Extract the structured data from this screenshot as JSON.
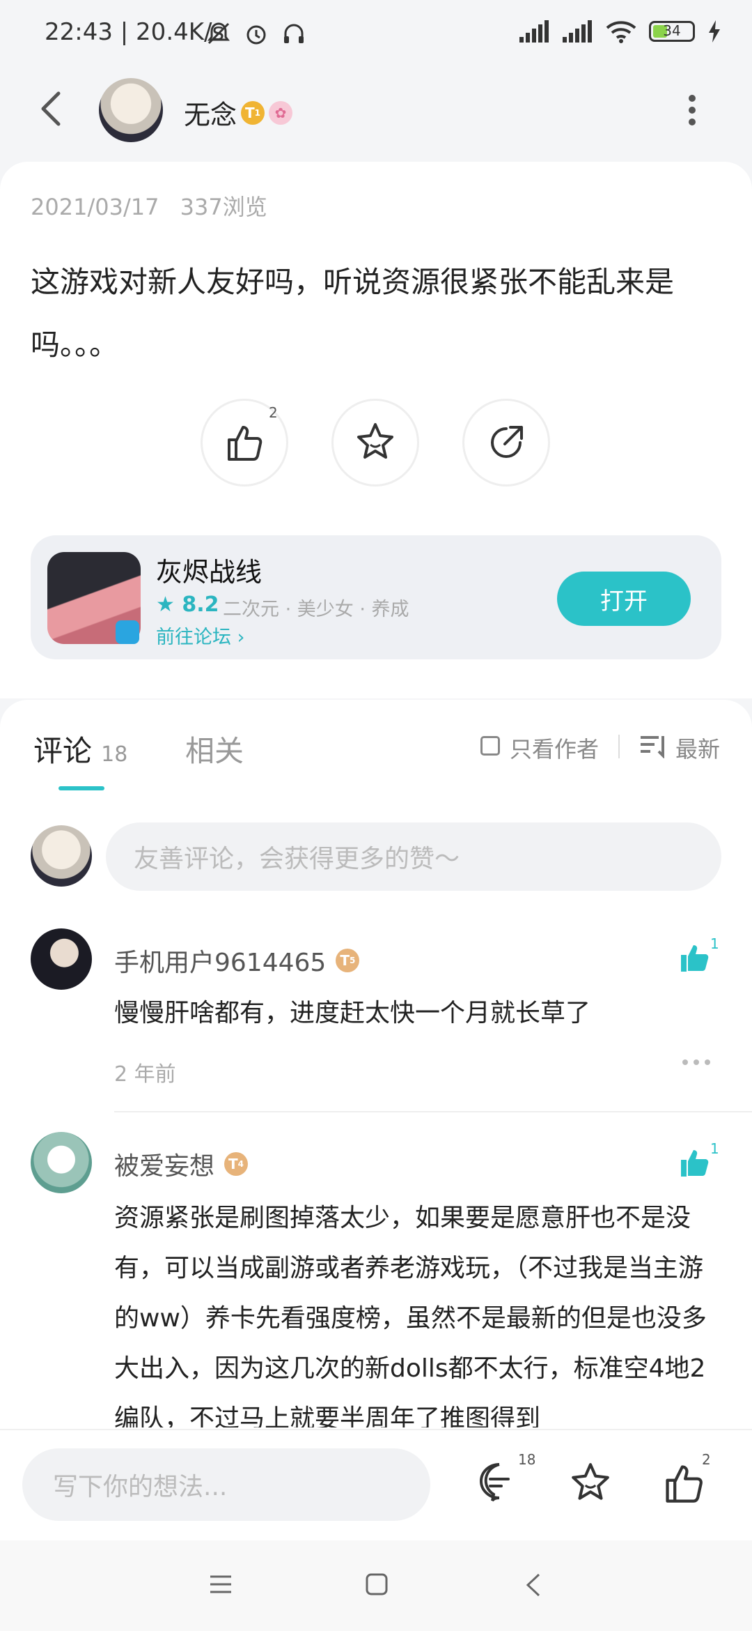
{
  "status_bar": {
    "time": "22:43 | 20.4K/s",
    "battery": "34"
  },
  "header": {
    "username": "无念",
    "badge_level": "T",
    "badge_level_sub": "1"
  },
  "post": {
    "date": "2021/03/17",
    "views": "337浏览",
    "content": "这游戏对新人友好吗，听说资源很紧张不能乱来是吗。。。",
    "like_count": "2"
  },
  "game_card": {
    "name": "灰烬战线",
    "rating": "8.2",
    "tags": "二次元 · 美少女 · 养成",
    "forum_link": "前往论坛",
    "open_label": "打开"
  },
  "comments_section": {
    "tab_comments": "评论",
    "comment_count": "18",
    "tab_related": "相关",
    "author_only": "只看作者",
    "sort_label": "最新",
    "input_placeholder": "友善评论，会获得更多的赞～"
  },
  "comments": [
    {
      "user": "手机用户9614465",
      "badge": "T",
      "badge_sub": "5",
      "text": "慢慢肝啥都有，进度赶太快一个月就长草了",
      "time": "2 年前",
      "likes": "1"
    },
    {
      "user": "被爱妄想",
      "badge": "T",
      "badge_sub": "4",
      "text": "资源紧张是刷图掉落太少，如果要是愿意肝也不是没有，可以当成副游或者养老游戏玩，（不过我是当主游的ww）养卡先看强度榜，虽然不是最新的但是也没多大出入，因为这几次的新dolls都不太行，标准空4地2编队，不过马上就要半周年了推图得到",
      "likes": "1"
    }
  ],
  "bottom_bar": {
    "placeholder": "写下你的想法...",
    "comment_count": "18",
    "like_count": "2"
  },
  "colors": {
    "accent": "#2bc2c8",
    "gold_badge": "#f0b433",
    "bronze_badge": "#e7b37a"
  }
}
